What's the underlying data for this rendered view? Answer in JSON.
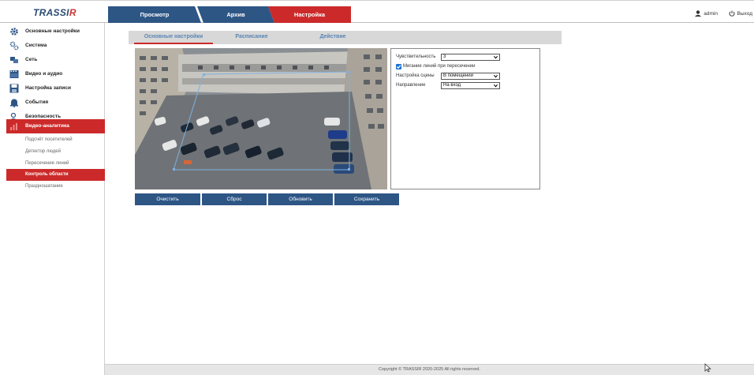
{
  "header": {
    "logo_main": "TRASSI",
    "logo_r": "R",
    "tabs": [
      {
        "label": "Просмотр",
        "color": "#2e5685"
      },
      {
        "label": "Архив",
        "color": "#2e5685"
      },
      {
        "label": "Настройка",
        "color": "#cc2a2a"
      }
    ],
    "user": "admin",
    "logout": "Выход"
  },
  "sidebar": {
    "items": [
      {
        "label": "Основные настройки",
        "icon": "gear-icon"
      },
      {
        "label": "Система",
        "icon": "gears-icon"
      },
      {
        "label": "Сеть",
        "icon": "network-icon"
      },
      {
        "label": "Видео и аудио",
        "icon": "film-icon"
      },
      {
        "label": "Настройка записи",
        "icon": "save-icon"
      },
      {
        "label": "События",
        "icon": "bell-icon"
      },
      {
        "label": "Безопасность",
        "icon": "user-shield-icon"
      },
      {
        "label": "Видео-аналитика",
        "icon": "analytics-icon"
      }
    ],
    "sub_items": [
      {
        "label": "Подсчёт посетителей"
      },
      {
        "label": "Детектор людей"
      },
      {
        "label": "Пересечение линий"
      },
      {
        "label": "Контроль области"
      },
      {
        "label": "Праздношатание"
      }
    ],
    "active_item": "Видео-аналитика",
    "active_sub": "Контроль области"
  },
  "subtabs": [
    {
      "label": "Основные настройки"
    },
    {
      "label": "Расписание"
    },
    {
      "label": "Действие"
    }
  ],
  "settings": {
    "sensitivity_label": "Чувствительность",
    "sensitivity_value": "3",
    "blink_label": "Мигание линий при пересечении",
    "blink_checked": true,
    "scene_label": "Настройка сцены",
    "scene_value": "В помещении",
    "direction_label": "Направление",
    "direction_value": "На вход"
  },
  "buttons": {
    "clear": "Очистить",
    "reset": "Сброс",
    "refresh": "Обновить",
    "save": "Сохранить"
  },
  "footer": {
    "copyright": "Copyright © TRASSIR 2020-2025 All rights reserved."
  },
  "colors": {
    "accent_red": "#cc2a2a",
    "accent_blue": "#2e5685",
    "subtab_text": "#5a86b5"
  }
}
